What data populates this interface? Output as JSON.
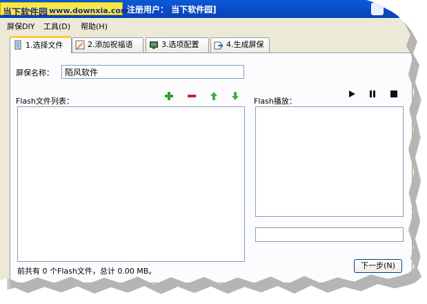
{
  "window": {
    "watermark_brand": "当下软件园",
    "watermark_url": "www.downxia.com",
    "title": "注册用户： 当下软件园]"
  },
  "menu": [
    {
      "label": "屏保DIY"
    },
    {
      "label": "工具(D)"
    },
    {
      "label": "帮助(H)"
    }
  ],
  "tabs": [
    {
      "label": "1.选择文件",
      "icon": "document-icon",
      "active": true
    },
    {
      "label": "2.添加祝福语",
      "icon": "pencil-icon",
      "active": false
    },
    {
      "label": "3.选项配置",
      "icon": "monitor-icon",
      "active": false
    },
    {
      "label": "4.生成屏保",
      "icon": "export-icon",
      "active": false
    }
  ],
  "form": {
    "name_label": "屏保名称：",
    "name_value": "陌风软件"
  },
  "flash_list": {
    "label": "Flash文件列表：",
    "tools": [
      "add-icon",
      "remove-icon",
      "move-up-icon",
      "move-down-icon"
    ],
    "status": "前共有 0 个Flash文件，总计 0.00 MB。"
  },
  "player": {
    "label": "Flash播放：",
    "controls": [
      "play-icon",
      "pause-icon",
      "stop-icon"
    ],
    "path_value": ""
  },
  "next_button": "下一步(N)",
  "colors": {
    "titlebar": "#0b4fcb",
    "watermark_bg": "#fbe84a",
    "tab_active_accent": "#ffc83c",
    "add_green": "#2fa02f",
    "remove_red": "#d02020",
    "arrow_green": "#3cb03c"
  }
}
